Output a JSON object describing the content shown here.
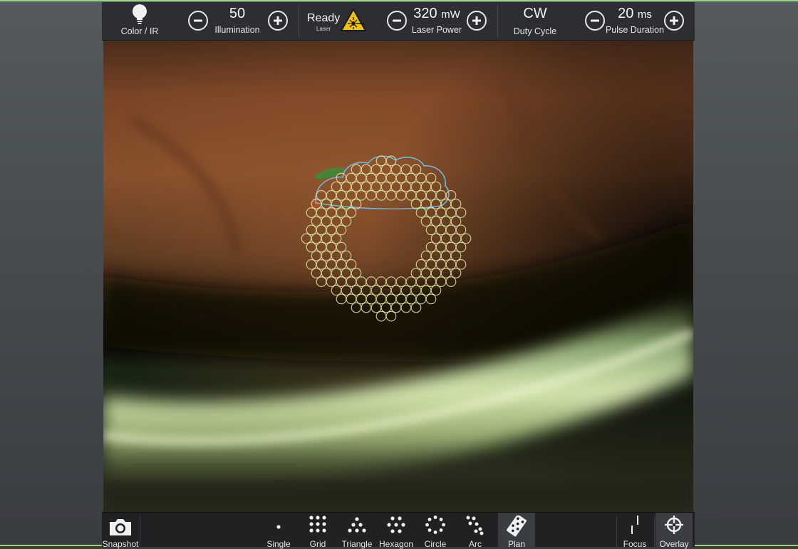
{
  "top": {
    "color_ir": {
      "label": "Color / IR"
    },
    "illumination": {
      "value": "50",
      "label": "Illumination"
    },
    "laser_status": {
      "value": "Ready",
      "sub": "Laser"
    },
    "laser_power": {
      "value": "320",
      "unit": "mW",
      "label": "Laser Power"
    },
    "duty_cycle": {
      "value": "CW",
      "label": "Duty Cycle"
    },
    "pulse_duration": {
      "value": "20",
      "unit": "ms",
      "label": "Pulse Duration"
    }
  },
  "bottom": {
    "snapshot": "Snapshot",
    "patterns": [
      {
        "key": "single",
        "label": "Single"
      },
      {
        "key": "grid",
        "label": "Grid"
      },
      {
        "key": "triangle",
        "label": "Triangle"
      },
      {
        "key": "hexagon",
        "label": "Hexagon"
      },
      {
        "key": "circle",
        "label": "Circle"
      },
      {
        "key": "arc",
        "label": "Arc"
      },
      {
        "key": "plan",
        "label": "Plan",
        "active": true
      }
    ],
    "focus": "Focus",
    "overlay": "Overlay"
  },
  "colors": {
    "warning": "#f2c200",
    "spot_ring": "#e6f0a8",
    "aim_outline": "#6fb8d8"
  },
  "icons": [
    "bulb-icon",
    "minus-icon",
    "plus-icon",
    "laser-warning-icon",
    "camera-icon",
    "focus-icon",
    "crosshair-icon"
  ]
}
